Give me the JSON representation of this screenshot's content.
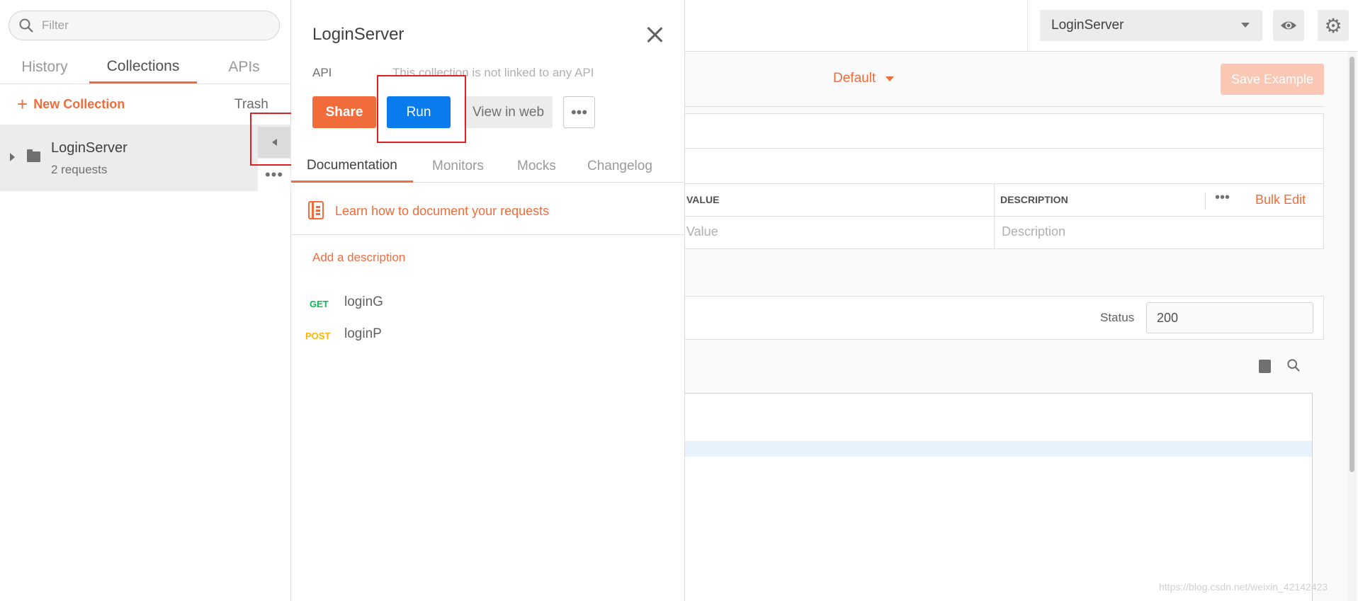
{
  "sidebar": {
    "filter_placeholder": "Filter",
    "tabs": [
      "History",
      "Collections",
      "APIs"
    ],
    "active_tab": "Collections",
    "new_collection": "New Collection",
    "trash": "Trash",
    "collection": {
      "name": "LoginServer",
      "count": "2 requests"
    },
    "accent_color": "#f26b3a"
  },
  "panel": {
    "title": "LoginServer",
    "api_label": "API",
    "api_text": "This collection is not linked to any API",
    "buttons": {
      "share": "Share",
      "run": "Run",
      "view_web": "View in web",
      "more": "•••"
    },
    "tabs": [
      "Documentation",
      "Monitors",
      "Mocks",
      "Changelog"
    ],
    "learn_text": "Learn how to document your requests",
    "add_description": "Add a description",
    "requests": [
      {
        "method": "GET",
        "name": "loginG",
        "color": "#0cbb52"
      },
      {
        "method": "POST",
        "name": "loginP",
        "color": "#ffb400"
      }
    ],
    "run_color": "#097bed"
  },
  "main": {
    "environment": "LoginServer",
    "default_dropdown": "Default",
    "save_example": "Save Example",
    "table": {
      "headers": {
        "value": "VALUE",
        "description": "DESCRIPTION"
      },
      "more": "•••",
      "bulk_edit": "Bulk Edit",
      "placeholders": {
        "value": "Value",
        "description": "Description"
      }
    },
    "status_label": "Status",
    "status_value": "200"
  },
  "watermark": "https://blog.csdn.net/weixin_42142423"
}
